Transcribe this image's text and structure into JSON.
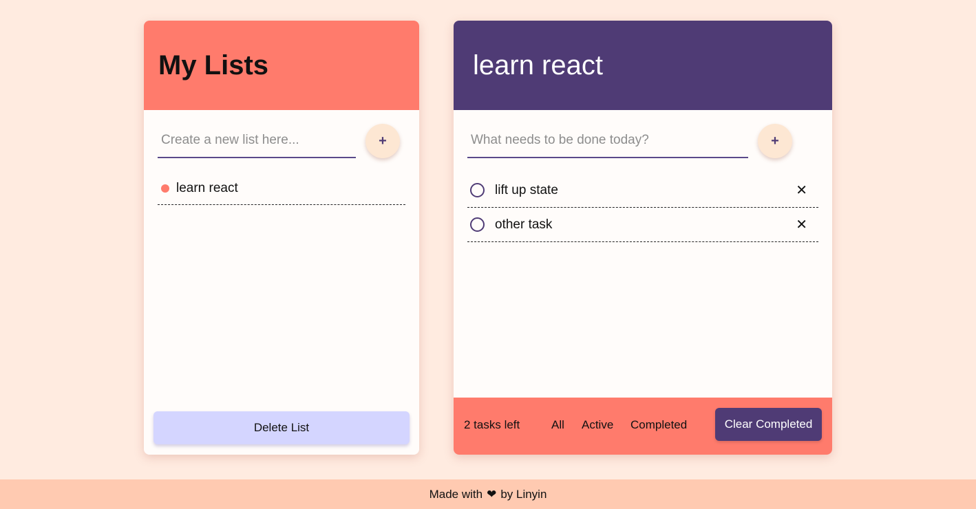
{
  "lists_panel": {
    "title": "My Lists",
    "input_placeholder": "Create a new list here...",
    "add_label": "+",
    "items": [
      {
        "label": "learn react"
      }
    ],
    "delete_label": "Delete List"
  },
  "tasks_panel": {
    "title": "learn react",
    "input_placeholder": "What needs to be done today?",
    "add_label": "+",
    "tasks": [
      {
        "label": "lift up state",
        "completed": false
      },
      {
        "label": "other task",
        "completed": false
      }
    ],
    "delete_icon": "close-icon",
    "footer": {
      "tasks_left": "2 tasks left",
      "filters": [
        "All",
        "Active",
        "Completed"
      ],
      "clear_label": "Clear Completed"
    }
  },
  "footer": {
    "made_with": "Made with",
    "heart": "❤",
    "by": "by Linyin"
  },
  "colors": {
    "background": "#ffebe0",
    "accent_coral": "#ff7b6c",
    "accent_purple": "#4f3b75",
    "delete_button": "#d4d5ff",
    "footer_bar": "#ffcab1"
  }
}
